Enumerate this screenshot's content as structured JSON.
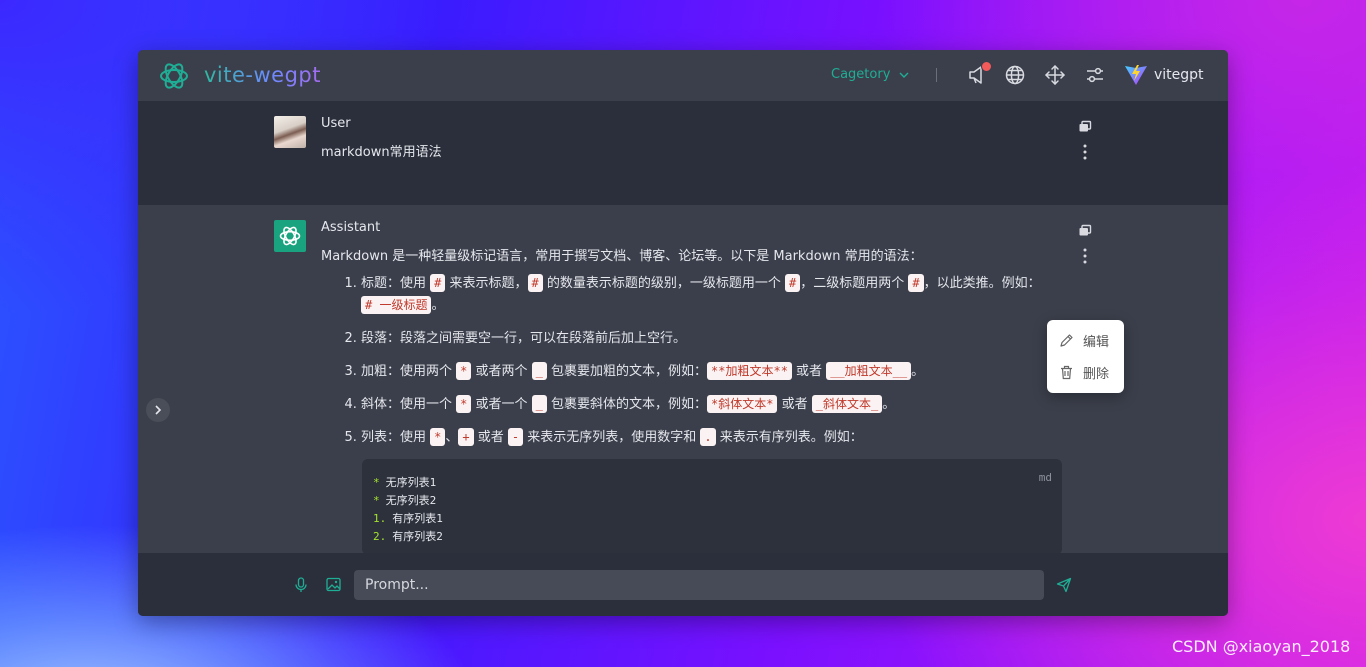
{
  "app": {
    "title": "vite-wegpt",
    "category": "Cagetory",
    "brand": "vitegpt",
    "accent": "#1fae95"
  },
  "messages": {
    "user": {
      "role": "User",
      "text": "markdown常用语法"
    },
    "assistant": {
      "role": "Assistant",
      "intro": "Markdown 是一种轻量级标记语言，常用于撰写文档、博客、论坛等。以下是 Markdown 常用的语法：",
      "items": {
        "i1": {
          "a": "标题：使用 ",
          "c1": "#",
          "b": " 来表示标题，",
          "c2": "#",
          "d": " 的数量表示标题的级别，一级标题用一个 ",
          "c3": "#",
          "e": "，二级标题用两个 ",
          "c4": "#",
          "f": "，以此类推。例如：",
          "c5": "# 一级标题",
          "g": "。"
        },
        "i2": {
          "a": "段落：段落之间需要空一行，可以在段落前后加上空行。"
        },
        "i3": {
          "a": "加粗：使用两个 ",
          "c1": "*",
          "b": " 或者两个 ",
          "c2": "_",
          "d": " 包裹要加粗的文本，例如：",
          "c3": "**加粗文本**",
          "e": " 或者 ",
          "c4": "__加粗文本__",
          "f": "。"
        },
        "i4": {
          "a": "斜体：使用一个 ",
          "c1": "*",
          "b": " 或者一个 ",
          "c2": "_",
          "d": " 包裹要斜体的文本，例如：",
          "c3": "*斜体文本*",
          "e": " 或者 ",
          "c4": "_斜体文本_",
          "f": "。"
        },
        "i5": {
          "a": "列表：使用 ",
          "c1": "*",
          "b": "、",
          "c2": "+",
          "d": " 或者 ",
          "c3": "-",
          "e": " 来表示无序列表，使用数字和 ",
          "c4": ".",
          "f": " 来表示有序列表。例如："
        }
      },
      "code": {
        "lang": "md",
        "lines": [
          {
            "marker": "*",
            "text": "无序列表1"
          },
          {
            "marker": "*",
            "text": "无序列表2"
          },
          {
            "marker": "1.",
            "text": "有序列表1"
          },
          {
            "marker": "2.",
            "text": "有序列表2"
          }
        ]
      }
    }
  },
  "context_menu": {
    "edit": "编辑",
    "delete": "删除"
  },
  "input": {
    "placeholder": "Prompt..."
  },
  "watermark": "CSDN @xiaoyan_2018"
}
